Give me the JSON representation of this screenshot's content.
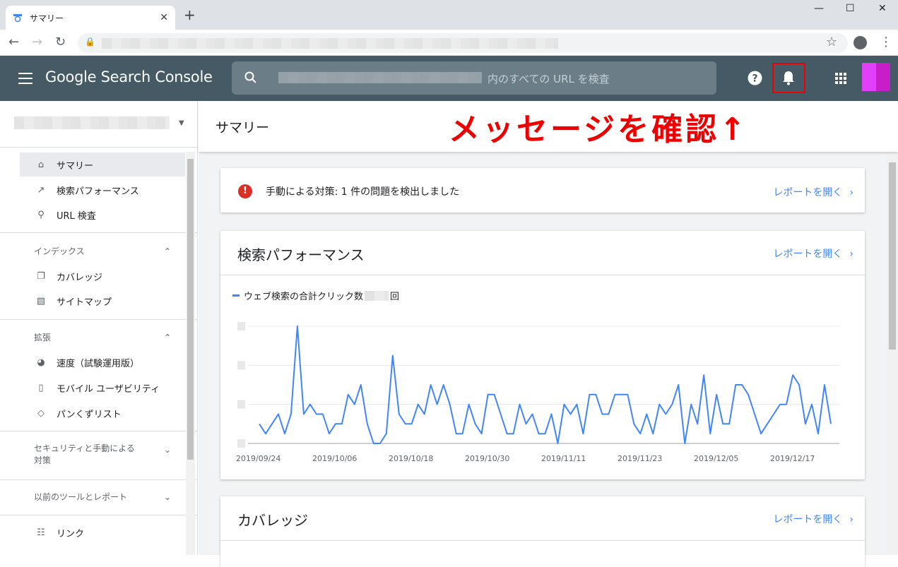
{
  "browser": {
    "tab_title": "サマリー",
    "new_tab": "+",
    "close_tab": "✕"
  },
  "header": {
    "brand": "Google Search Console",
    "search_placeholder": "内のすべての URL を検査"
  },
  "sidebar": {
    "items_top": [
      {
        "label": "サマリー",
        "icon": "home-icon",
        "active": true
      },
      {
        "label": "検索パフォーマンス",
        "icon": "trending-up-icon"
      },
      {
        "label": "URL 検査",
        "icon": "search-icon"
      }
    ],
    "section_index": "インデックス",
    "items_index": [
      {
        "label": "カバレッジ",
        "icon": "copy-icon"
      },
      {
        "label": "サイトマップ",
        "icon": "sitemap-icon"
      }
    ],
    "section_ext": "拡張",
    "items_ext": [
      {
        "label": "速度（試験運用版）",
        "icon": "speed-icon"
      },
      {
        "label": "モバイル ユーザビリティ",
        "icon": "phone-icon"
      },
      {
        "label": "パンくずリスト",
        "icon": "layers-icon"
      }
    ],
    "section_security": "セキュリティと手動による対策",
    "section_legacy": "以前のツールとレポート",
    "items_legacy": [
      {
        "label": "リンク",
        "icon": "link-tree-icon"
      }
    ]
  },
  "main": {
    "title": "サマリー",
    "annotation": "メッセージを確認↑",
    "alert": {
      "text": "手動による対策: 1 件の問題を検出しました",
      "link": "レポートを開く"
    },
    "performance": {
      "title": "検索パフォーマンス",
      "link": "レポートを開く",
      "legend_prefix": "ウェブ検索の合計クリック数",
      "legend_suffix": "回"
    },
    "coverage": {
      "title": "カバレッジ",
      "link": "レポートを開く"
    }
  },
  "colors": {
    "appbar": "#455a64",
    "series": "#4285f4",
    "annotation": "#ee0000",
    "alert": "#d93025"
  },
  "chart_data": {
    "type": "line",
    "title": "",
    "xlabel": "",
    "ylabel": "",
    "grid": true,
    "x_tick_labels": [
      "2019/09/24",
      "2019/10/06",
      "2019/10/18",
      "2019/10/30",
      "2019/11/11",
      "2019/11/23",
      "2019/12/05",
      "2019/12/17"
    ],
    "ylim": [
      0,
      6
    ],
    "series": [
      {
        "name": "ウェブ検索の合計クリック数",
        "color": "#4285f4",
        "values": [
          1,
          0.5,
          1,
          1.5,
          0.5,
          1.5,
          6,
          1.5,
          2,
          1.5,
          1.5,
          0.5,
          1,
          1,
          2.5,
          2,
          3,
          1,
          0,
          0,
          0.5,
          4.5,
          1.5,
          1,
          1,
          2,
          1.5,
          3,
          2,
          3,
          2,
          0.5,
          0.5,
          2,
          1,
          0.5,
          2.5,
          2.5,
          1.5,
          0.5,
          0.5,
          2,
          1,
          1.5,
          0.5,
          0.5,
          1.5,
          0,
          2,
          1.5,
          2,
          0.5,
          2.5,
          2.5,
          1.5,
          1.5,
          2.5,
          2.5,
          2.5,
          1,
          0.5,
          1.5,
          0.5,
          2,
          1.5,
          2,
          3,
          0,
          2,
          1,
          3.5,
          0.5,
          2.5,
          1,
          1,
          3,
          3,
          2.5,
          1.5,
          0.5,
          1,
          1.5,
          2,
          2,
          3.5,
          3,
          1,
          2,
          0.5,
          3,
          1
        ]
      }
    ]
  }
}
